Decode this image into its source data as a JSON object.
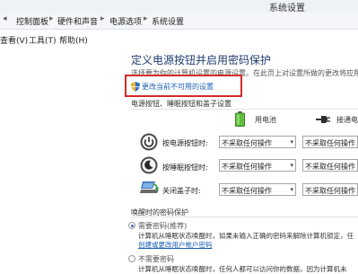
{
  "window": {
    "title": "系统设置"
  },
  "breadcrumb": {
    "items": [
      "控制面板",
      "硬件和声音",
      "电源选项",
      "系统设置"
    ],
    "separator": "▸"
  },
  "menu": {
    "items": [
      "查看(V)",
      "工具(T)",
      "帮助(H)"
    ]
  },
  "page": {
    "title": "定义电源按钮并启用密码保护",
    "description": "选择要为你的计算机设置的电源设置。在此页上对设置所做的更改将应用于你",
    "change_link": "更改当前不可用的设置"
  },
  "button_section": {
    "title": "电源按钮、睡眠按钮和盖子设置",
    "columns": [
      "用电池",
      "接通电源"
    ],
    "rows": [
      {
        "icon": "power-icon",
        "label": "按电源按钮时:",
        "battery": "不采取任何操作",
        "plugged": "不采取任何操作"
      },
      {
        "icon": "sleep-icon",
        "label": "按睡眠按钮时:",
        "battery": "不采取任何操作",
        "plugged": "不采取任何操作"
      },
      {
        "icon": "lid-icon",
        "label": "关闭盖子时:",
        "battery": "不采取任何操作",
        "plugged": "不采取任何操作"
      }
    ]
  },
  "wake_section": {
    "title": "唤醒时的密码保护",
    "options": [
      {
        "label": "需要密码(推荐)",
        "selected": true,
        "description": "计算机从睡眠状态唤醒时，如果未输入正确的密码来解除计算机锁定，任",
        "link": "创建或更改用户帐户密码"
      },
      {
        "label": "不需要密码",
        "selected": false,
        "description": "计算机从睡眠状态唤醒时，任何人都可以访问你的数据，因为计算机未"
      }
    ]
  },
  "colors": {
    "accent": "#1a5fb4",
    "highlight": "#d52a2a",
    "heading": "#1e3c6e"
  }
}
